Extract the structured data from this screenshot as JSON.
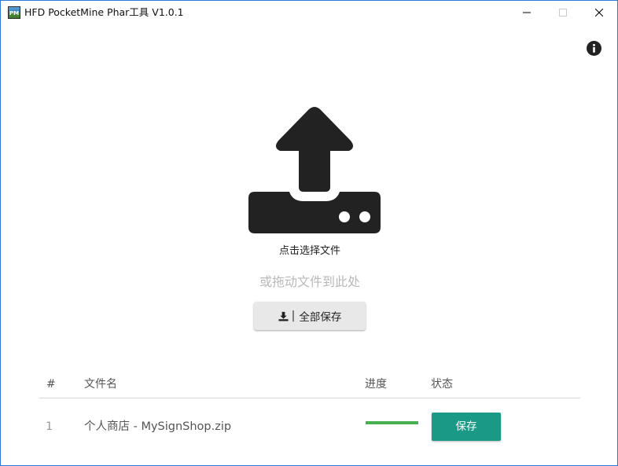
{
  "window": {
    "title": "HFD PocketMine Phar工具 V1.0.1",
    "icon_text": "PM"
  },
  "controls": {
    "minimize_icon": "minimize-icon",
    "maximize_icon": "maximize-icon",
    "close_icon": "close-icon",
    "info_icon": "info-icon"
  },
  "upload": {
    "icon": "upload-icon",
    "click_label": "点击选择文件",
    "drag_hint": "或拖动文件到此处"
  },
  "save_all": {
    "icon": "download-icon",
    "separator": "|",
    "label": "全部保存"
  },
  "table": {
    "headers": {
      "index": "#",
      "filename": "文件名",
      "progress": "进度",
      "status": "状态"
    },
    "rows": [
      {
        "index": "1",
        "filename": "个人商店 - MySignShop.zip",
        "progress": 1.0,
        "status_button": "保存"
      }
    ]
  },
  "colors": {
    "accent": "#1a9a86",
    "progress": "#45b04d",
    "window_border": "#2b7ad9",
    "icon_dark": "#222222"
  }
}
